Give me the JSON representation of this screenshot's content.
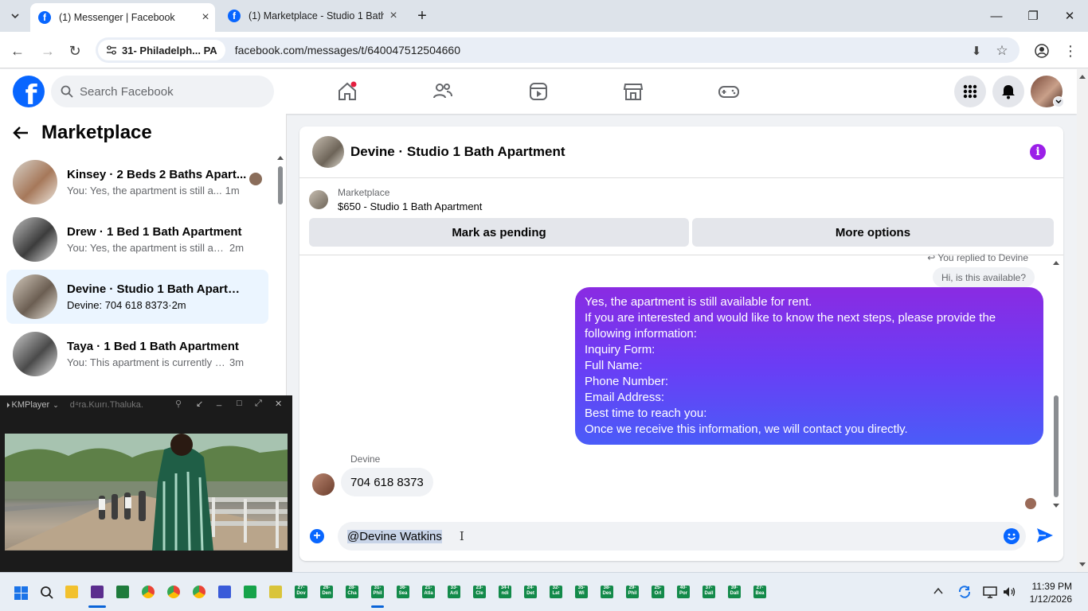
{
  "browser": {
    "tabs": [
      {
        "title": "(1) Messenger | Facebook",
        "active": true
      },
      {
        "title": "(1) Marketplace - Studio 1 Bath",
        "active": false
      }
    ],
    "site_chip": "31- Philadelph... PA",
    "url": "facebook.com/messages/t/640047512504660"
  },
  "fb": {
    "search_placeholder": "Search Facebook",
    "logo_letter": "f"
  },
  "left": {
    "title": "Marketplace",
    "conversations": [
      {
        "name": "Kinsey · 2 Beds 2 Baths Apart...",
        "preview": "You: Yes, the apartment is still a...",
        "time": "1m",
        "selected": false
      },
      {
        "name": "Drew · 1 Bed 1 Bath Apartment",
        "preview": "You: Yes, the apartment is still avail...",
        "time": "2m",
        "selected": false
      },
      {
        "name": "Devine · Studio 1 Bath Apartment",
        "preview": "Devine: 704 618 8373",
        "time": "2m",
        "selected": true
      },
      {
        "name": "Taya · 1 Bed 1 Bath Apartment",
        "preview": "You: This apartment is currently op...",
        "time": "3m",
        "selected": false
      }
    ]
  },
  "kmplayer": {
    "app": "KMPlayer",
    "title": "d⁴ra.Kuırı.Thaluka."
  },
  "chat": {
    "title": "Devine · Studio 1 Bath Apartment",
    "listing_source": "Marketplace",
    "listing_title": "$650 - Studio 1 Bath Apartment",
    "btn_pending": "Mark as pending",
    "btn_more": "More options",
    "replied_label": "You replied to Devine",
    "quoted_text": "Hi, is this available?",
    "outgoing_lines": [
      "Yes, the apartment is still available for rent.",
      "If you are interested and would like to know the next steps, please provide the following information:",
      "Inquiry Form:",
      "Full Name:",
      "Phone Number:",
      "Email Address:",
      "Best time to reach you:",
      "Once we receive this information, we will contact you directly."
    ],
    "sender_name": "Devine",
    "incoming_text": "704 618 8373",
    "composer_mention": "@Devine Watkins"
  },
  "taskbar": {
    "time": "11:39 PM",
    "date": "1/12/2026",
    "pinned": [
      "27- Dov",
      "26- Den",
      "28- Cha",
      "31- Phil",
      "36- Sea",
      "21- Atla",
      "33- Arli",
      "23- Cle",
      "34-I ndi",
      "24- Det",
      "32- Lat",
      "35- Wi",
      "38- Des",
      "29- Phil",
      "25- Orl",
      "40- Por",
      "37- Dall",
      "39- Dall",
      "27- Bea"
    ]
  },
  "colors": {
    "fb_blue": "#0866ff",
    "bubble_gradient_top": "#8a2be2",
    "bubble_gradient_bottom": "#4a5cf8",
    "selected_row": "#ebf5ff"
  }
}
